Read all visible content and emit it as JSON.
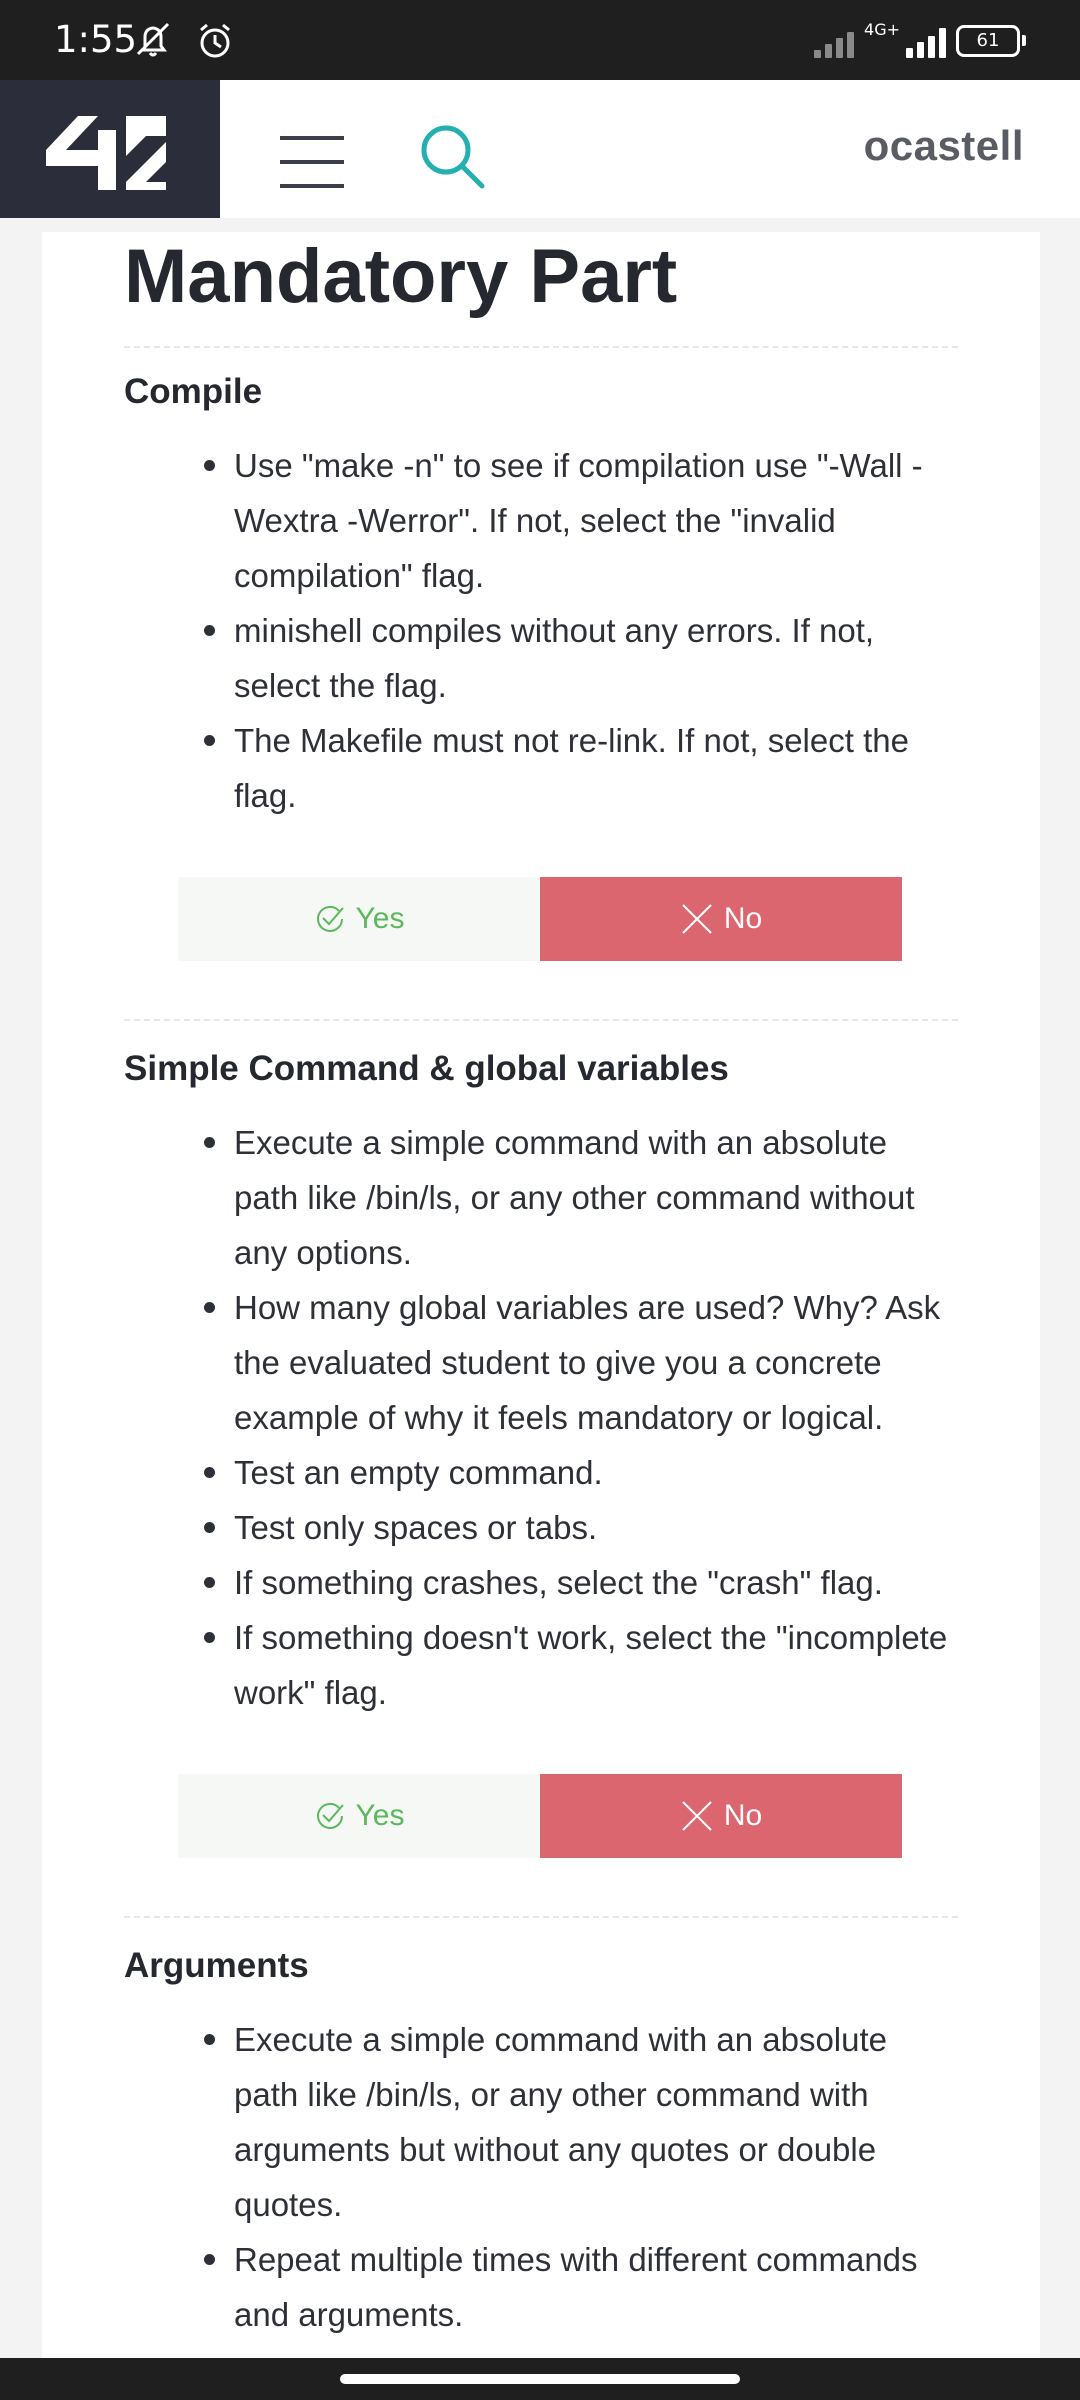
{
  "status_bar": {
    "time": "1:55",
    "network": "4G+",
    "battery": "61",
    "icons": [
      "notifications-muted-icon",
      "alarm-icon",
      "signal-icon",
      "battery-icon"
    ]
  },
  "header": {
    "logo": "42",
    "username": "ocastell",
    "icons": [
      "menu-icon",
      "search-icon"
    ],
    "accent_color": "#24b0b0"
  },
  "page": {
    "title": "Mandatory Part",
    "sections": [
      {
        "title": "Compile",
        "bullets": [
          "Use \"make -n\" to see if compilation use \"-Wall -Wextra -Werror\". If not, select the \"invalid compilation\" flag.",
          "minishell compiles without any errors. If not, select the flag.",
          "The Makefile must not re-link. If not, select the flag."
        ],
        "yes_label": "Yes",
        "no_label": "No"
      },
      {
        "title": "Simple Command & global variables",
        "bullets": [
          "Execute a simple command with an absolute path like /bin/ls, or any other command without any options.",
          "How many global variables are used? Why? Ask the evaluated student to give you a concrete example of why it feels mandatory or logical.",
          "Test an empty command.",
          "Test only spaces or tabs.",
          "If something crashes, select the \"crash\" flag.",
          "If something doesn't work, select the \"incomplete work\" flag."
        ],
        "yes_label": "Yes",
        "no_label": "No"
      },
      {
        "title": "Arguments",
        "bullets": [
          "Execute a simple command with an absolute path like /bin/ls, or any other command with arguments but without any quotes or double quotes.",
          "Repeat multiple times with different commands and arguments."
        ]
      }
    ]
  },
  "colors": {
    "yes_text": "#5cb85c",
    "no_background": "#dc6670",
    "logo_background": "#2b2d3a"
  }
}
